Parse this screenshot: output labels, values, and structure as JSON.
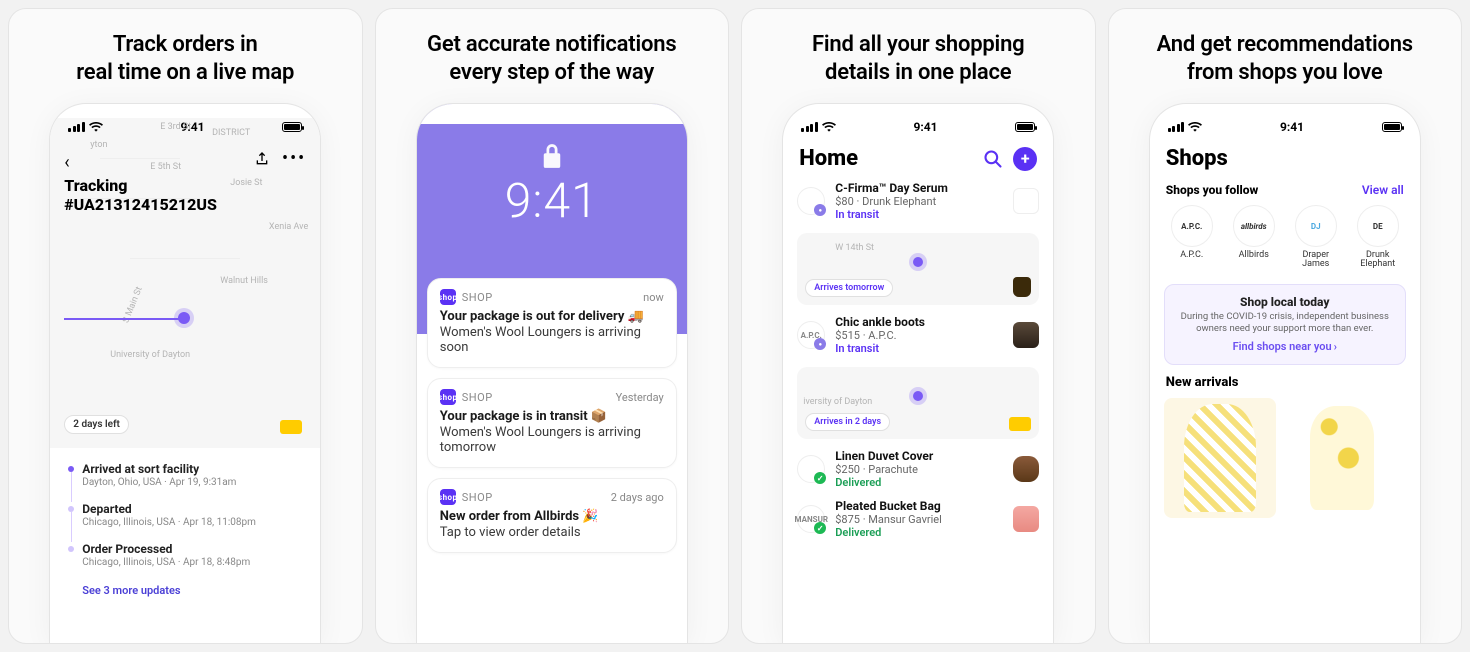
{
  "statusTime": "9:41",
  "panel1": {
    "title": "Track orders in\nreal time on a live map",
    "trackingLabel": "Tracking",
    "trackingNumber": "#UA21312415212US",
    "pill": "2 days left",
    "streets": [
      "E 3rd St",
      "E 5th St",
      "Josie St",
      "Xenia Ave",
      "S Main St",
      "Walnut Hills",
      "University of Dayton"
    ],
    "districts": [
      "yton",
      "DISTRICT"
    ],
    "timeline": [
      {
        "title": "Arrived at sort facility",
        "meta": "Dayton, Ohio, USA · Apr 19, 9:31am"
      },
      {
        "title": "Departed",
        "meta": "Chicago, Illinois, USA · Apr 18, 11:08pm"
      },
      {
        "title": "Order Processed",
        "meta": "Chicago, Illinois, USA · Apr 18, 8:48pm"
      }
    ],
    "more": "See 3 more updates"
  },
  "panel2": {
    "title": "Get accurate notifications\nevery step of the way",
    "lockTime": "9:41",
    "appName": "SHOP",
    "notifications": [
      {
        "when": "now",
        "title": "Your package is out for delivery 🚚",
        "body": "Women's Wool Loungers is arriving soon"
      },
      {
        "when": "Yesterday",
        "title": "Your package is in transit 📦",
        "body": "Women's Wool Loungers is arriving tomorrow"
      },
      {
        "when": "2 days ago",
        "title": "New order from Allbirds 🎉",
        "body": "Tap to view order details"
      }
    ]
  },
  "panel3": {
    "title": "Find all your shopping\ndetails in one place",
    "header": "Home",
    "map1": {
      "pill": "Arrives tomorrow",
      "street": "W 14th St"
    },
    "map2": {
      "pill": "Arrives in 2 days",
      "street": "iversity of Dayton"
    },
    "orders": [
      {
        "title": "C-Firma™ Day Serum",
        "meta": "$80 · Drunk Elephant",
        "status": "In transit",
        "statusClass": "st-transit",
        "logo": "transit"
      },
      {
        "title": "Chic ankle boots",
        "meta": "$515 · A.P.C.",
        "status": "In transit",
        "statusClass": "st-transit",
        "logo": "transit",
        "logoText": "A.P.C."
      },
      {
        "title": "Linen Duvet Cover",
        "meta": "$250 · Parachute",
        "status": "Delivered",
        "statusClass": "st-delivered",
        "logo": "ok"
      },
      {
        "title": "Pleated Bucket Bag",
        "meta": "$875 · Mansur Gavriel",
        "status": "Delivered",
        "statusClass": "st-delivered",
        "logo": "ok",
        "logoText": "MANSUR"
      }
    ]
  },
  "panel4": {
    "title": "And get recommendations\nfrom shops you love",
    "header": "Shops",
    "followLabel": "Shops you follow",
    "viewAll": "View all",
    "brands": [
      {
        "logo": "A.P.C.",
        "name": "A.P.C."
      },
      {
        "logo": "allbirds",
        "name": "Allbirds"
      },
      {
        "logo": "DJ",
        "name": "Draper James"
      },
      {
        "logo": "DE",
        "name": "Drunk Elephant"
      }
    ],
    "promo": {
      "title": "Shop local today",
      "text": "During the COVID-19 crisis, independent business owners need your support more than ever.",
      "link": "Find shops near you"
    },
    "newArrivals": "New arrivals"
  }
}
